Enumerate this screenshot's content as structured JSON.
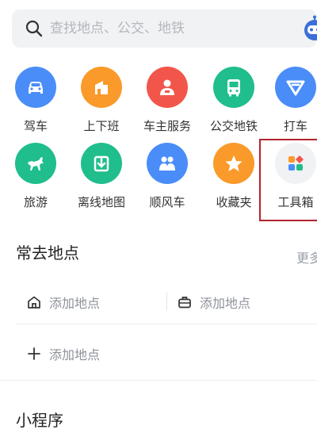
{
  "search": {
    "placeholder": "查找地点、公交、地铁"
  },
  "grid": {
    "row1": [
      {
        "label": "驾车",
        "icon": "car-icon",
        "color": "#4a8df8"
      },
      {
        "label": "上下班",
        "icon": "commute-icon",
        "color": "#fa9a2a"
      },
      {
        "label": "车主服务",
        "icon": "driver-service-icon",
        "color": "#f2564b"
      },
      {
        "label": "公交地铁",
        "icon": "bus-icon",
        "color": "#1fbe8c"
      },
      {
        "label": "打车",
        "icon": "taxi-icon",
        "color": "#4a8df8"
      }
    ],
    "row2": [
      {
        "label": "旅游",
        "icon": "horse-icon",
        "color": "#1fbe8c"
      },
      {
        "label": "离线地图",
        "icon": "download-icon",
        "color": "#1fbe8c"
      },
      {
        "label": "顺风车",
        "icon": "carpool-icon",
        "color": "#4a8df8"
      },
      {
        "label": "收藏夹",
        "icon": "star-icon",
        "color": "#fa9a2a"
      },
      {
        "label": "工具箱",
        "icon": "toolbox-icon",
        "color": "#f1f2f4"
      }
    ]
  },
  "frequent_places": {
    "title": "常去地点",
    "more": "更多",
    "home_label": "添加地点",
    "work_label": "添加地点",
    "add_label": "添加地点"
  },
  "mini_programs": {
    "title": "小程序"
  }
}
